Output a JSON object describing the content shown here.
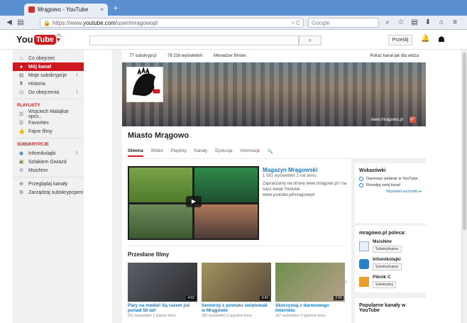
{
  "browser": {
    "tab_title": "Mrągowo - YouTube",
    "tab_close": "×",
    "new_tab": "+",
    "url_prefix": "https://www.",
    "url_host": "youtube.com",
    "url_path": "/user/mragowopl",
    "search_engine": "Google",
    "icons": [
      "download-icon",
      "home-icon",
      "bookmark-star-icon",
      "search-icon",
      "menu-icon"
    ]
  },
  "youtube": {
    "logo_you": "You",
    "logo_tube": "Tube",
    "logo_country": "PL",
    "search_button": "🔍",
    "upload_label": "Prześlij"
  },
  "sidebar": {
    "items": [
      {
        "label": "Co obejrzeć",
        "icon": "home-icon",
        "count": ""
      },
      {
        "label": "Mój kanał",
        "icon": "user-icon",
        "count": "",
        "active": true
      },
      {
        "label": "Moje subskrypcje",
        "icon": "subscriptions-icon",
        "count": "1"
      },
      {
        "label": "Historia",
        "icon": "history-icon",
        "count": ""
      },
      {
        "label": "Do obejrzenia",
        "icon": "clock-icon",
        "count": "1"
      }
    ],
    "playlists_heading": "PLAYLISTY",
    "playlists": [
      {
        "label": "Wojciech Malajkat opro..."
      },
      {
        "label": "Favorites"
      },
      {
        "label": "Fajne filmy"
      }
    ],
    "subscriptions_heading": "SUBSKRYPCJE",
    "subscriptions": [
      {
        "label": "Infomikolajki",
        "count": "1"
      },
      {
        "label": "Szlakiem Gwiazd",
        "count": ""
      },
      {
        "label": "MsisNmr",
        "count": ""
      }
    ],
    "bottom": [
      {
        "label": "Przeglądaj kanały"
      },
      {
        "label": "Zarządzaj subskrypcjami"
      }
    ]
  },
  "channel": {
    "subscribers": "77 subskrypcji",
    "views": "79 216 wyświetleń",
    "manager": "Menedżer filmów",
    "view_as": "Pokaż kanał jak dla widza",
    "banner_link": "www.mragowo.pl",
    "name": "Miasto Mrągowo",
    "tabs": [
      "Główna",
      "Wideo",
      "Playlisty",
      "Kanały",
      "Dyskusja",
      "Informacje",
      "🔍"
    ],
    "featured": {
      "title": "Magazyn Mrągowski",
      "meta": "1 081 wyświetleń  1 rok temu",
      "description": "Zapraszamy na stronę www.mragowo.pl i na nasz kanał Youtube: www.youtube.pl/mragowopl"
    },
    "uploads_title": "Przesłane filmy",
    "uploads": [
      {
        "title": "Pary na medal! Są razem już ponad 50 lat!",
        "meta": "251 wyświetleń  1 tydzień temu",
        "duration": "4:02"
      },
      {
        "title": "Seniorzy z powiatu świętowali w Mrągowie",
        "meta": "285 wyświetleń  2 tygodnie temu",
        "duration": "3:42"
      },
      {
        "title": "Skorzystaj z darmowego Internetu",
        "meta": "167 wyświetleń  3 tygodnie temu",
        "duration": "2:50"
      }
    ]
  },
  "right": {
    "tips_title": "Wskazówki",
    "tips": [
      "Darmowy webinar w YouTube",
      "Rozwijaj swój kanał"
    ],
    "tips_link": "Wyświetl wszystko ▸",
    "recommends_title": "mragowo.pl poleca:",
    "recommends": [
      {
        "name": "MsisNmr",
        "button": "Subskrybujesz"
      },
      {
        "name": "Infomikolajki",
        "button": "Subskrybujesz"
      },
      {
        "name": "Piknik C",
        "button": "Subskrybuj"
      }
    ],
    "popular_title": "Popularne kanały w YouTube"
  },
  "colors": {
    "accent": "#cc181e",
    "link": "#167ac6"
  }
}
